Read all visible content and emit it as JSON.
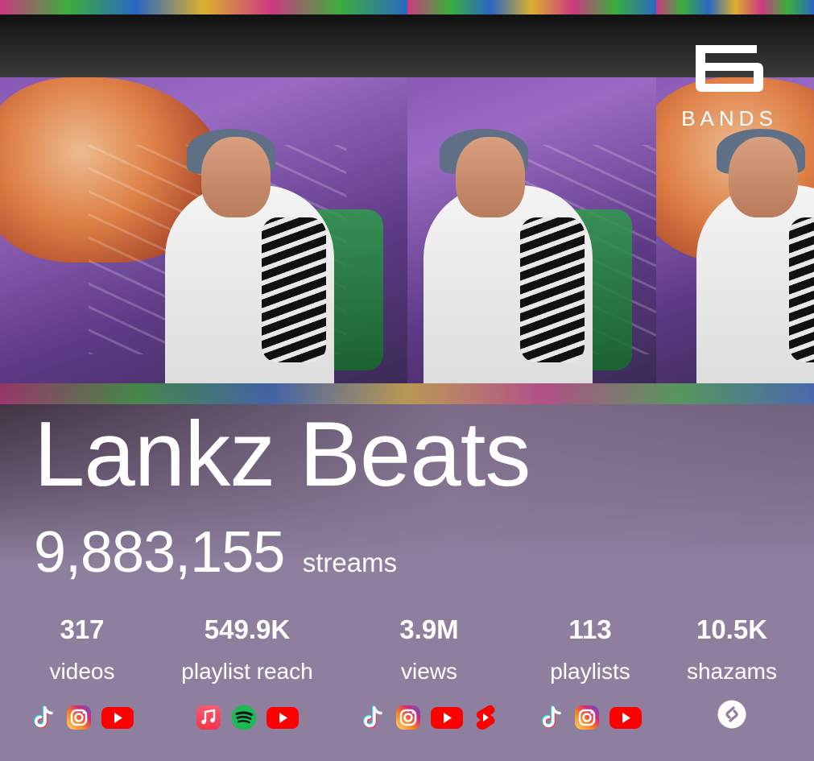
{
  "brand": {
    "logo_text": "BANDS"
  },
  "artist": {
    "name": "Lankz Beats"
  },
  "streams": {
    "count": "9,883,155",
    "label": "streams"
  },
  "stats": [
    {
      "value": "317",
      "label": "videos",
      "icons": [
        "tiktok-icon",
        "instagram-icon",
        "youtube-icon"
      ]
    },
    {
      "value": "549.9K",
      "label": "playlist reach",
      "icons": [
        "apple-music-icon",
        "spotify-icon",
        "youtube-icon"
      ]
    },
    {
      "value": "3.9M",
      "label": "views",
      "icons": [
        "tiktok-icon",
        "instagram-icon",
        "youtube-icon",
        "youtube-shorts-icon"
      ]
    },
    {
      "value": "113",
      "label": "playlists",
      "icons": [
        "tiktok-icon",
        "instagram-icon",
        "youtube-icon"
      ]
    },
    {
      "value": "10.5K",
      "label": "shazams",
      "icons": [
        "shazam-icon"
      ]
    }
  ],
  "colors": {
    "background": "#8e7f9e",
    "text": "#ffffff",
    "youtube": "#ff0000",
    "spotify": "#1db954",
    "apple_music": "#fa3c55"
  }
}
